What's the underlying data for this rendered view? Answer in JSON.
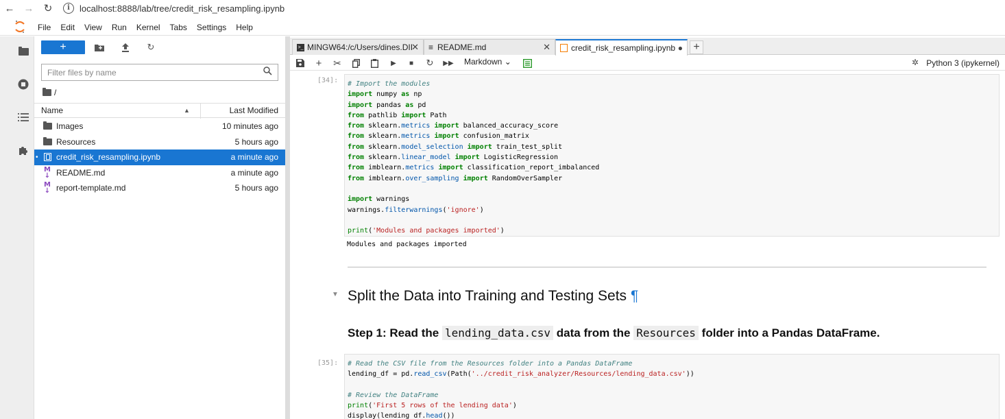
{
  "browser": {
    "url": "localhost:8888/lab/tree/credit_risk_resampling.ipynb"
  },
  "menu": [
    "File",
    "Edit",
    "View",
    "Run",
    "Kernel",
    "Tabs",
    "Settings",
    "Help"
  ],
  "filebrowser": {
    "new_label": "+",
    "filter_placeholder": "Filter files by name",
    "breadcrumb": "/",
    "col_name": "Name",
    "col_modified": "Last Modified",
    "files": [
      {
        "name": "Images",
        "modified": "10 minutes ago",
        "type": "folder"
      },
      {
        "name": "Resources",
        "modified": "5 hours ago",
        "type": "folder"
      },
      {
        "name": "credit_risk_resampling.ipynb",
        "modified": "a minute ago",
        "type": "notebook",
        "selected": true
      },
      {
        "name": "README.md",
        "modified": "a minute ago",
        "type": "markdown"
      },
      {
        "name": "report-template.md",
        "modified": "5 hours ago",
        "type": "markdown"
      }
    ]
  },
  "tabs": [
    {
      "label": "MINGW64:/c/Users/dines.DII",
      "icon": "terminal-icon"
    },
    {
      "label": "README.md",
      "icon": "markdown-icon"
    },
    {
      "label": "credit_risk_resampling.ipynb",
      "icon": "notebook-icon",
      "active": true
    }
  ],
  "toolbar": {
    "cell_type": "Markdown",
    "kernel": "Python 3 (ipykernel)"
  },
  "cells": {
    "cell34": {
      "prompt": "[34]:",
      "output": "Modules and packages imported"
    },
    "heading": "Split the Data into Training and Testing Sets",
    "heading_anchor": "¶",
    "step1": {
      "pre": "Step 1: Read the",
      "code1": "lending_data.csv",
      "mid": "data from the",
      "code2": "Resources",
      "post": "folder into a Pandas DataFrame."
    },
    "cell35": {
      "prompt": "[35]:"
    }
  },
  "colors": {
    "accent": "#1976d2",
    "selected_row": "#1976d2"
  }
}
